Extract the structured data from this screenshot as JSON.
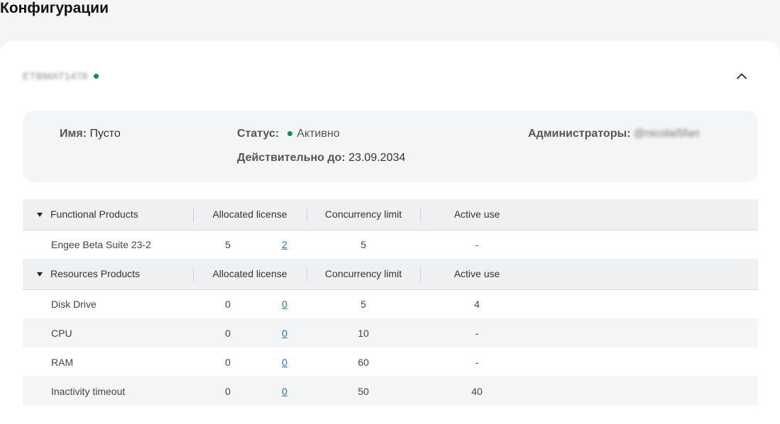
{
  "page": {
    "title": "Конфигурации"
  },
  "config": {
    "id": "ETBMAT1478",
    "status_color": "#1a8a4a",
    "collapse_icon": "chevron-up-icon",
    "info": {
      "name_label": "Имя:",
      "name_value": "Пусто",
      "status_label": "Статус:",
      "status_value": "Активно",
      "valid_label": "Действительно до:",
      "valid_value": "23.09.2034",
      "admins_label": "Администраторы:",
      "admins_value": "@nicolai5fan"
    }
  },
  "table": {
    "columns": {
      "allocated": "Allocated license",
      "concurrency": "Concurrency limit",
      "active": "Active use"
    },
    "groups": [
      {
        "name": "Functional Products",
        "rows": [
          {
            "name": "Engee Beta Suite 23-2",
            "allocated": "5",
            "allocated_link": "2",
            "concurrency": "5",
            "active": "-"
          }
        ]
      },
      {
        "name": "Resources Products",
        "rows": [
          {
            "name": "Disk Drive",
            "allocated": "0",
            "allocated_link": "0",
            "concurrency": "5",
            "active": "4"
          },
          {
            "name": "CPU",
            "allocated": "0",
            "allocated_link": "0",
            "concurrency": "10",
            "active": "-"
          },
          {
            "name": "RAM",
            "allocated": "0",
            "allocated_link": "0",
            "concurrency": "60",
            "active": "-"
          },
          {
            "name": "Inactivity timeout",
            "allocated": "0",
            "allocated_link": "0",
            "concurrency": "50",
            "active": "40"
          }
        ]
      }
    ]
  }
}
